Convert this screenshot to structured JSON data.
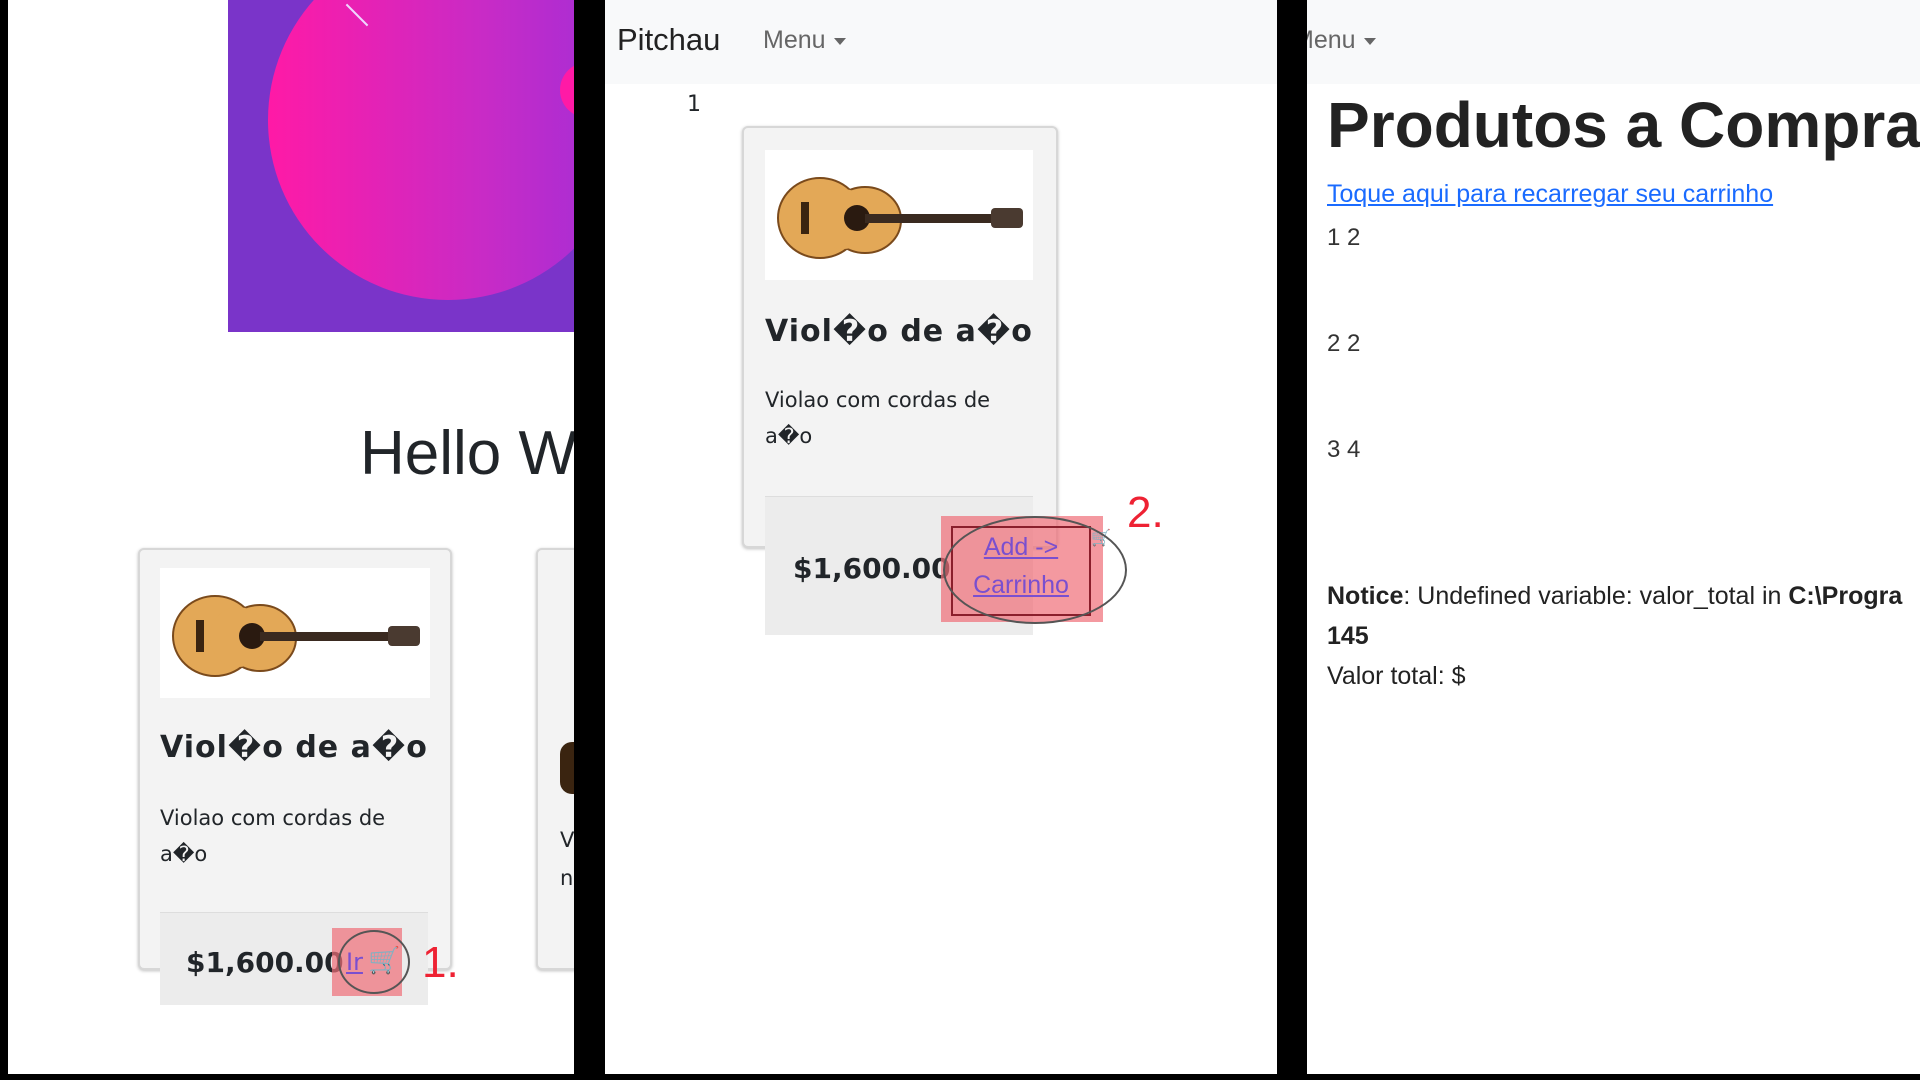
{
  "panel1": {
    "hello": "Hello W",
    "card": {
      "title": "Viol�o de a�o",
      "text_line1": "Violao com cordas de",
      "text_line2": "a�o",
      "price": "$1,600.00",
      "link": "Ir"
    },
    "card2_text_a": "V",
    "card2_text_b": "n",
    "marker": "1."
  },
  "panel2": {
    "brand": "Pitchau",
    "menu": "Menu",
    "index": "1",
    "card": {
      "title": "Viol�o de a�o",
      "text_line1": "Violao com cordas de",
      "text_line2": "a�o",
      "price": "$1,600.00",
      "add_line1": "Add ->",
      "add_line2": "Carrinho"
    },
    "marker": "2."
  },
  "panel3": {
    "menu": "Menu",
    "heading": "Produtos a Comprar",
    "reload_link": "Toque aqui para recarregar seu carrinho",
    "rows": [
      "1 2",
      "2 2",
      "3 4"
    ],
    "notice_label": "Notice",
    "notice_text": ": Undefined variable: valor_total in ",
    "notice_path": "C:\\Progra",
    "notice_line": "145",
    "total": "Valor total: $"
  }
}
